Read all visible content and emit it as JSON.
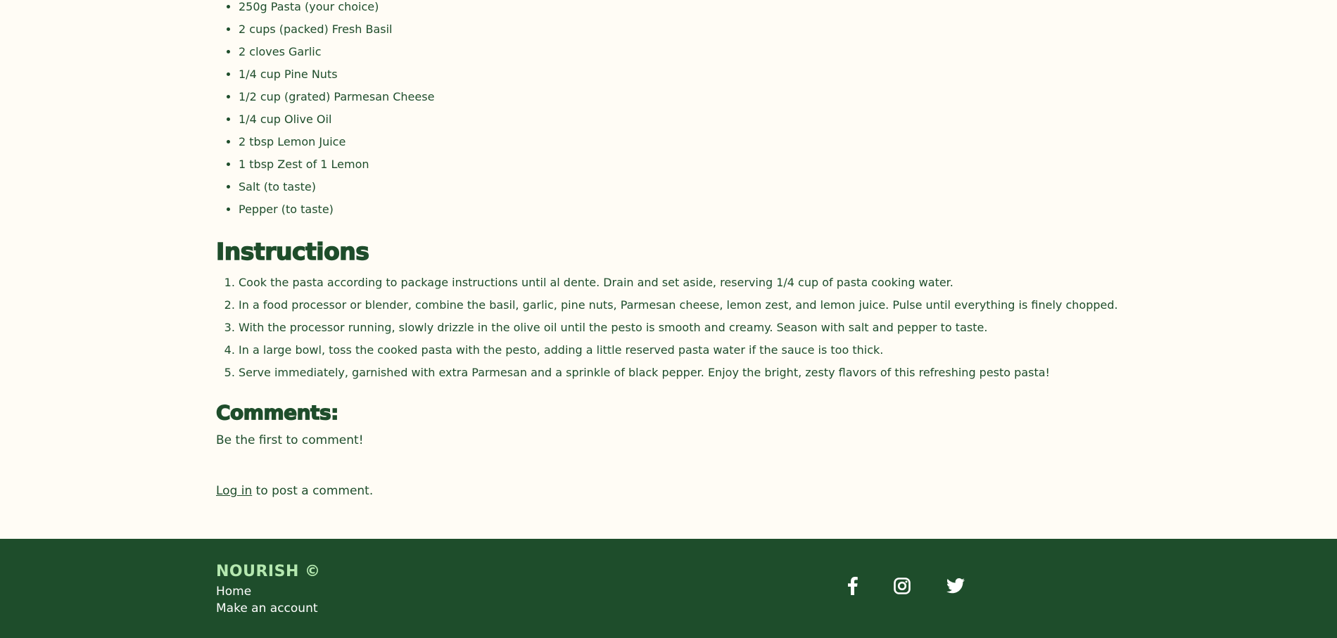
{
  "ingredients": [
    "250g Pasta (your choice)",
    "2 cups (packed) Fresh Basil",
    "2 cloves Garlic",
    "1/4 cup Pine Nuts",
    "1/2 cup (grated) Parmesan Cheese",
    "1/4 cup Olive Oil",
    "2 tbsp Lemon Juice",
    "1 tbsp Zest of 1 Lemon",
    "Salt (to taste)",
    "Pepper (to taste)"
  ],
  "instructions": {
    "title": "Instructions",
    "steps": [
      "Cook the pasta according to package instructions until al dente. Drain and set aside, reserving 1/4 cup of pasta cooking water.",
      "In a food processor or blender, combine the basil, garlic, pine nuts, Parmesan cheese, lemon zest, and lemon juice. Pulse until everything is finely chopped.",
      "With the processor running, slowly drizzle in the olive oil until the pesto is smooth and creamy. Season with salt and pepper to taste.",
      "In a large bowl, toss the cooked pasta with the pesto, adding a little reserved pasta water if the sauce is too thick.",
      "Serve immediately, garnished with extra Parmesan and a sprinkle of black pepper. Enjoy the bright, zesty flavors of this refreshing pesto pasta!"
    ]
  },
  "comments": {
    "title": "Comments:",
    "empty_text": "Be the first to comment!",
    "login_link": "Log in",
    "login_suffix": " to post a comment."
  },
  "footer": {
    "brand": "NOURISH ©",
    "links": {
      "home": "Home",
      "make_account": "Make an account"
    },
    "social_icons": [
      "facebook-icon",
      "instagram-icon",
      "twitter-icon"
    ]
  },
  "colors": {
    "background": "#fffcf5",
    "text": "#1e4d2b",
    "footer_bg": "#1e4d2b",
    "brand_accent": "#b5e8b0",
    "footer_text": "#ffffff"
  }
}
